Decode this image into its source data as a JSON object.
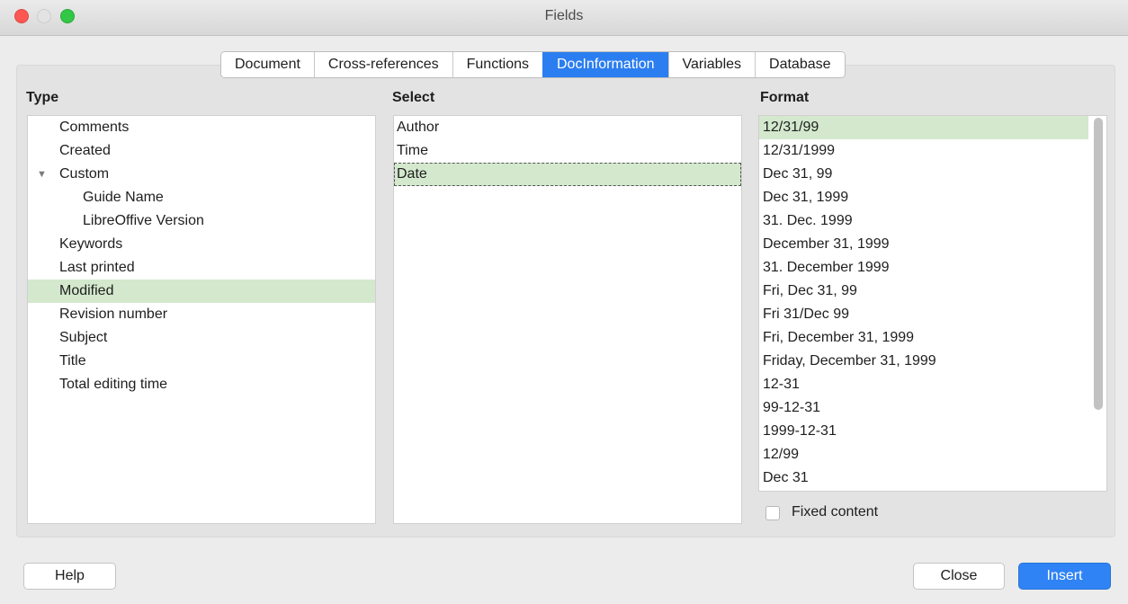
{
  "window": {
    "title": "Fields"
  },
  "tabs": [
    {
      "label": "Document"
    },
    {
      "label": "Cross-references"
    },
    {
      "label": "Functions"
    },
    {
      "label": "DocInformation",
      "active": true
    },
    {
      "label": "Variables"
    },
    {
      "label": "Database"
    }
  ],
  "type": {
    "title": "Type",
    "items": [
      {
        "label": "Comments"
      },
      {
        "label": "Created"
      },
      {
        "label": "Custom",
        "expanded": true
      },
      {
        "label": "Guide Name"
      },
      {
        "label": "LibreOffive Version"
      },
      {
        "label": "Keywords"
      },
      {
        "label": "Last printed"
      },
      {
        "label": "Modified",
        "selected": true
      },
      {
        "label": "Revision number"
      },
      {
        "label": "Subject"
      },
      {
        "label": "Title"
      },
      {
        "label": "Total editing time"
      }
    ]
  },
  "select": {
    "title": "Select",
    "items": [
      {
        "label": "Author"
      },
      {
        "label": "Time"
      },
      {
        "label": "Date",
        "selected": true
      }
    ]
  },
  "format": {
    "title": "Format",
    "items": [
      {
        "label": "12/31/99",
        "selected": true
      },
      {
        "label": "12/31/1999"
      },
      {
        "label": "Dec 31, 99"
      },
      {
        "label": "Dec 31, 1999"
      },
      {
        "label": "31. Dec. 1999"
      },
      {
        "label": "December 31, 1999"
      },
      {
        "label": "31. December 1999"
      },
      {
        "label": "Fri, Dec 31, 99"
      },
      {
        "label": "Fri 31/Dec 99"
      },
      {
        "label": "Fri, December 31, 1999"
      },
      {
        "label": "Friday, December 31, 1999"
      },
      {
        "label": "12-31"
      },
      {
        "label": "99-12-31"
      },
      {
        "label": "1999-12-31"
      },
      {
        "label": "12/99"
      },
      {
        "label": "Dec 31"
      }
    ],
    "fixed_content_label": "Fixed content",
    "fixed_content_checked": false
  },
  "buttons": {
    "help": "Help",
    "close": "Close",
    "insert": "Insert"
  },
  "colors": {
    "accent": "#2b7ef0",
    "selection": "#d3e8cd"
  }
}
